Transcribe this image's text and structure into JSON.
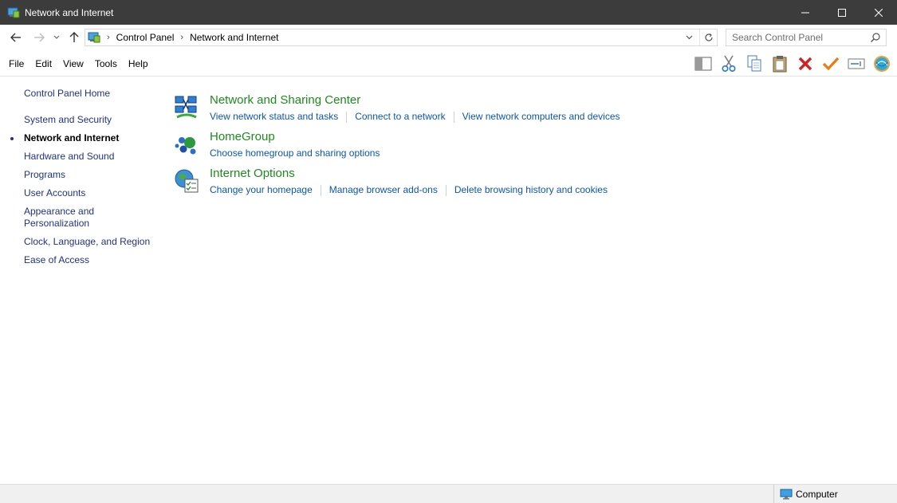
{
  "window": {
    "title": "Network and Internet",
    "controls": [
      "minimize-icon",
      "maximize-icon",
      "close-icon"
    ]
  },
  "address": {
    "crumbs": [
      "Control Panel",
      "Network and Internet"
    ],
    "search_placeholder": "Search Control Panel"
  },
  "menu": {
    "items": [
      "File",
      "Edit",
      "View",
      "Tools",
      "Help"
    ]
  },
  "toolbar": {
    "icons": [
      "layout-pane-icon",
      "cut-icon",
      "copy-icon",
      "paste-icon",
      "delete-icon",
      "check-icon",
      "rename-icon",
      "shell-icon"
    ]
  },
  "leftnav": {
    "home": "Control Panel Home",
    "items": [
      {
        "label": "System and Security",
        "active": false
      },
      {
        "label": "Network and Internet",
        "active": true
      },
      {
        "label": "Hardware and Sound",
        "active": false
      },
      {
        "label": "Programs",
        "active": false
      },
      {
        "label": "User Accounts",
        "active": false
      },
      {
        "label": "Appearance and Personalization",
        "active": false
      },
      {
        "label": "Clock, Language, and Region",
        "active": false
      },
      {
        "label": "Ease of Access",
        "active": false
      }
    ]
  },
  "categories": [
    {
      "title": "Network and Sharing Center",
      "icon": "network-sharing-icon",
      "links": [
        "View network status and tasks",
        "Connect to a network",
        "View network computers and devices"
      ]
    },
    {
      "title": "HomeGroup",
      "icon": "homegroup-icon",
      "links": [
        "Choose homegroup and sharing options"
      ]
    },
    {
      "title": "Internet Options",
      "icon": "internet-options-icon",
      "links": [
        "Change your homepage",
        "Manage browser add-ons",
        "Delete browsing history and cookies"
      ]
    }
  ],
  "statusbar": {
    "location": "Computer"
  },
  "colors": {
    "titlebar": "#3c3c3c",
    "category_title": "#1d8a1d",
    "link": "#0b55b4",
    "nav_link": "#1e3287"
  }
}
